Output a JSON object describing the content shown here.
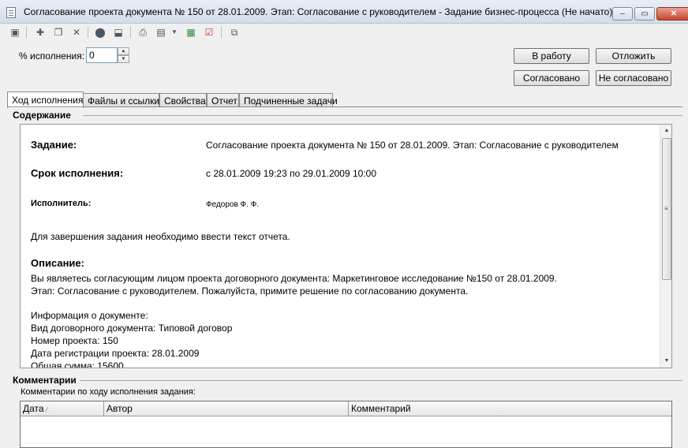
{
  "window": {
    "title": "Согласование проекта документа № 150 от 28.01.2009. Этап: Согласование с руководителем - Задание бизнес-процесса (Не начато)"
  },
  "toolbar": {
    "icons": [
      "save-icon",
      "new-icon",
      "copy-icon",
      "delete-icon",
      "post-icon",
      "unpost-icon",
      "print-icon",
      "document-icon",
      "dropdown-icon",
      "excel-icon",
      "checklist-icon",
      "structure-icon"
    ]
  },
  "form": {
    "percent_label": "% исполнения:",
    "percent_value": "0"
  },
  "buttons": {
    "to_work": "В работу",
    "postpone": "Отложить",
    "approved": "Согласовано",
    "not_approved": "Не согласовано"
  },
  "tabs": [
    {
      "label": "Ход исполнения",
      "active": true
    },
    {
      "label": "Файлы и ссылки"
    },
    {
      "label": "Свойства"
    },
    {
      "label": "Отчет"
    },
    {
      "label": "Подчиненные задачи"
    }
  ],
  "content": {
    "section_title": "Содержание",
    "task_label": "Задание:",
    "task_value": "Согласование проекта документа № 150 от 28.01.2009. Этап: Согласование с руководителем",
    "deadline_label": "Срок исполнения:",
    "deadline_value": "с 28.01.2009 19:23 по 29.01.2009 10:00",
    "executor_label": "Исполнитель:",
    "executor_value": "Федоров Ф. Ф.",
    "report_note": "Для завершения задания необходимо ввести текст отчета.",
    "description_label": "Описание:",
    "description_lines": [
      "Вы являетесь согласующим лицом проекта договорного документа: Маркетинговое исследование №150 от 28.01.2009.",
      "Этап: Согласование с руководителем. Пожалуйста, примите решение по согласованию документа."
    ],
    "doc_info_lines": [
      "Информация о документе:",
      "Вид договорного документа: Типовой договор",
      "Номер проекта: 150",
      "Дата регистрации проекта: 28.01.2009",
      "Общая сумма: 15600"
    ]
  },
  "comments": {
    "section_title": "Комментарии",
    "label": "Комментарии по ходу исполнения задания:",
    "columns": [
      "Дата",
      "Автор",
      "Комментарий"
    ]
  }
}
